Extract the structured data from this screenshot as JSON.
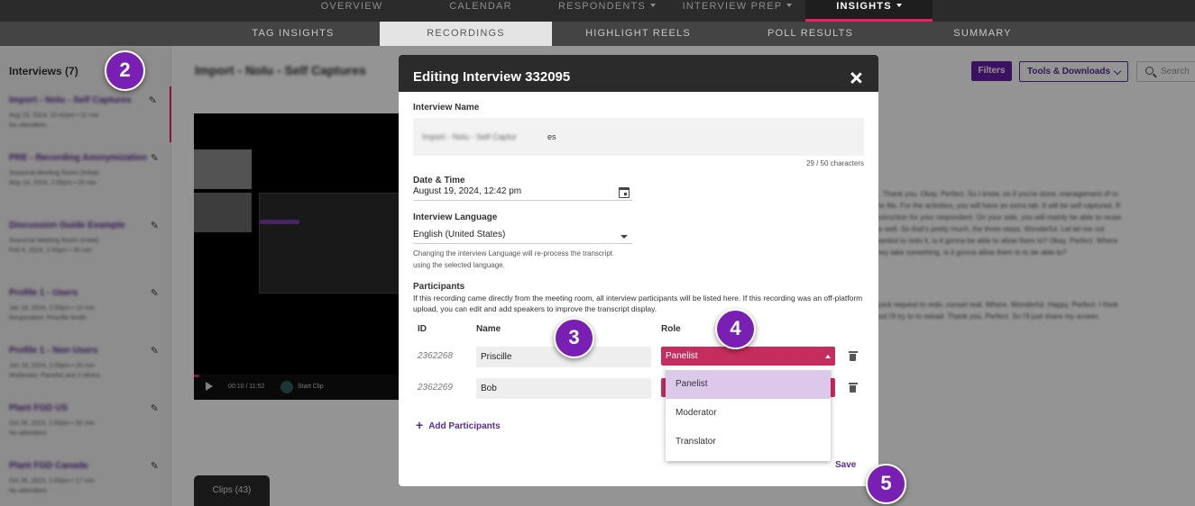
{
  "topnav": {
    "items": [
      "OVERVIEW",
      "CALENDAR",
      "RESPONDENTS",
      "INTERVIEW PREP",
      "INSIGHTS"
    ]
  },
  "subnav": {
    "items": [
      "TAG INSIGHTS",
      "RECORDINGS",
      "HIGHLIGHT REELS",
      "POLL RESULTS",
      "SUMMARY"
    ]
  },
  "sidebar": {
    "title": "Interviews (7)",
    "items": [
      {
        "name": "Import - Nolu - Self Captures",
        "meta1": "Aug 19, 2024, 12:42pm • 11 min",
        "meta2": "No attendees"
      },
      {
        "name": "PRE - Recording Anonymization",
        "meta1": "Seasonal Meeting Room (Initial)",
        "meta2": "May 14, 2024, 2:00pm • 25 min"
      },
      {
        "name": "Discussion Guide Example",
        "meta1": "Seasonal Meeting Room (Initial)",
        "meta2": "Feb 6, 2024, 2:00pm • 30 min"
      },
      {
        "name": "Profile 1 - Users",
        "meta1": "Jan 18, 2024, 2:00pm • 10 min",
        "meta2": "Respondent: Priscilla Smith"
      },
      {
        "name": "Profile 1 - Non Users",
        "meta1": "Jan 18, 2024, 1:00pm • 20 min",
        "meta2": "Moderator, Panelist and 2 others"
      },
      {
        "name": "Plant FGD US",
        "meta1": "Oct 26, 2023, 1:00pm • 30 min",
        "meta2": "No attendees"
      },
      {
        "name": "Plant FGD Canada",
        "meta1": "Oct 26, 2023, 1:00pm • 17 min",
        "meta2": "No attendees"
      }
    ]
  },
  "page": {
    "title": "Import - Nolu - Self Captures"
  },
  "video": {
    "time": "00:10 / 11:52",
    "clip_label": "Start Clip",
    "progress": 0.014
  },
  "clips_tab": "Clips (43)",
  "toolbar": {
    "filters": "Filters",
    "tools": "Tools & Downloads",
    "search_placeholder": "Search"
  },
  "transcript_lines": [
    "... Thank you. Okay. Perfect. So I know, so if you're done, management of ro",
    "the file. For the activities, you will have an extra tab. It will be self captured. R",
    "instruction for your respondent. On your side, you will mainly be able to reuse",
    "as well. So that's pretty much, the three steps. Wonderful. Let let me cut",
    "wanted to redo it, is it gonna be able to allow them to? Okay. Perfect. Where",
    "they take something, is it gonna allow them to to be able to?",
    "",
    "",
    "",
    "quick request to redo. conset real. Where. Wonderful. Happy. Perfect. I think",
    "and I'll try to to reload. Thank you. Perfect. So I'll just share my screen."
  ],
  "modal": {
    "title": "Editing Interview 332095",
    "name_label": "Interview Name",
    "name_value_blurred": "Import - Nolu - Self Captur",
    "name_value_tail": "es",
    "char_count": "29 / 50 characters",
    "datetime_label": "Date & Time",
    "datetime_value": "August 19, 2024, 12:42 pm",
    "language_label": "Interview Language",
    "language_value": "English (United States)",
    "language_help": "Changing the interview Language will re-process the transcript using the selected language.",
    "participants_label": "Participants",
    "participants_desc": "If this recording came directly from the meeting room, all interview participants will be listed here. If this recording was an off-platform upload, you can edit and add speakers to improve the transcript display.",
    "columns": {
      "id": "ID",
      "name": "Name",
      "role": "Role"
    },
    "participants": [
      {
        "id": "2362268",
        "name": "Priscille",
        "role": "Panelist"
      },
      {
        "id": "2362269",
        "name": "Bob",
        "role": ""
      }
    ],
    "role_options": [
      "Panelist",
      "Moderator",
      "Translator"
    ],
    "add_participants": "Add Participants",
    "save": "Save"
  },
  "annotations": [
    "2",
    "3",
    "4",
    "5"
  ],
  "colors": {
    "accent_purple": "#5a2d91",
    "role_pink": "#c72c5e",
    "active_underline": "#e91e63",
    "badge": "#7a1fb3"
  }
}
